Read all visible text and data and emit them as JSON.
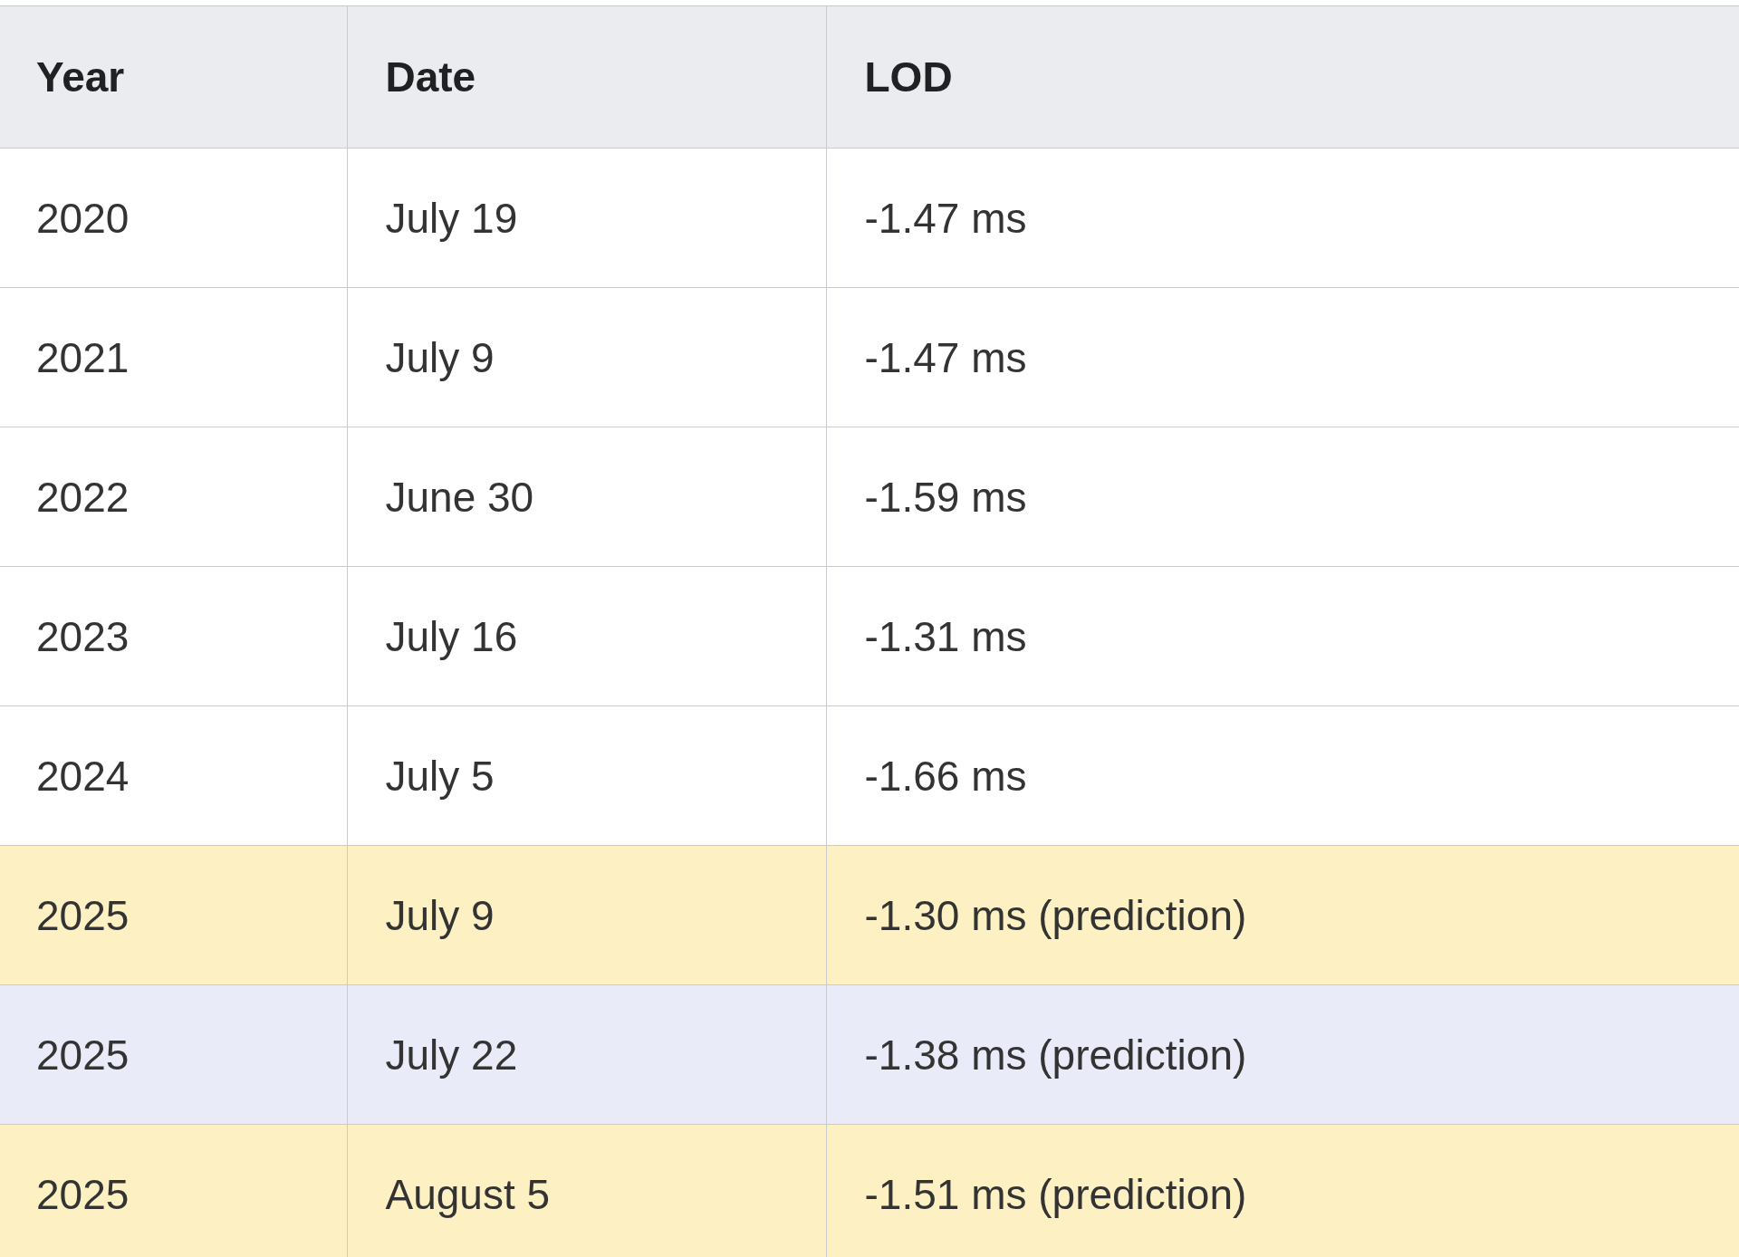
{
  "table": {
    "columns": [
      "Year",
      "Date",
      "LOD"
    ],
    "rows": [
      {
        "cells": [
          "2020",
          "July 19",
          "-1.47 ms"
        ]
      },
      {
        "cells": [
          "2021",
          "July 9",
          "-1.47 ms"
        ]
      },
      {
        "cells": [
          "2022",
          "June 30",
          "-1.59 ms"
        ]
      },
      {
        "cells": [
          "2023",
          "July 16",
          "-1.31 ms"
        ]
      },
      {
        "cells": [
          "2024",
          "July 5",
          "-1.66 ms"
        ]
      },
      {
        "cells": [
          "2025",
          "July 9",
          "-1.30 ms (prediction)"
        ],
        "color": "#fdf0c2"
      },
      {
        "cells": [
          "2025",
          "July 22",
          "-1.38 ms (prediction)"
        ],
        "color": "#eaebf8"
      },
      {
        "cells": [
          "2025",
          "August 5",
          "-1.51 ms (prediction)"
        ],
        "color": "#fdf0c2"
      }
    ]
  }
}
